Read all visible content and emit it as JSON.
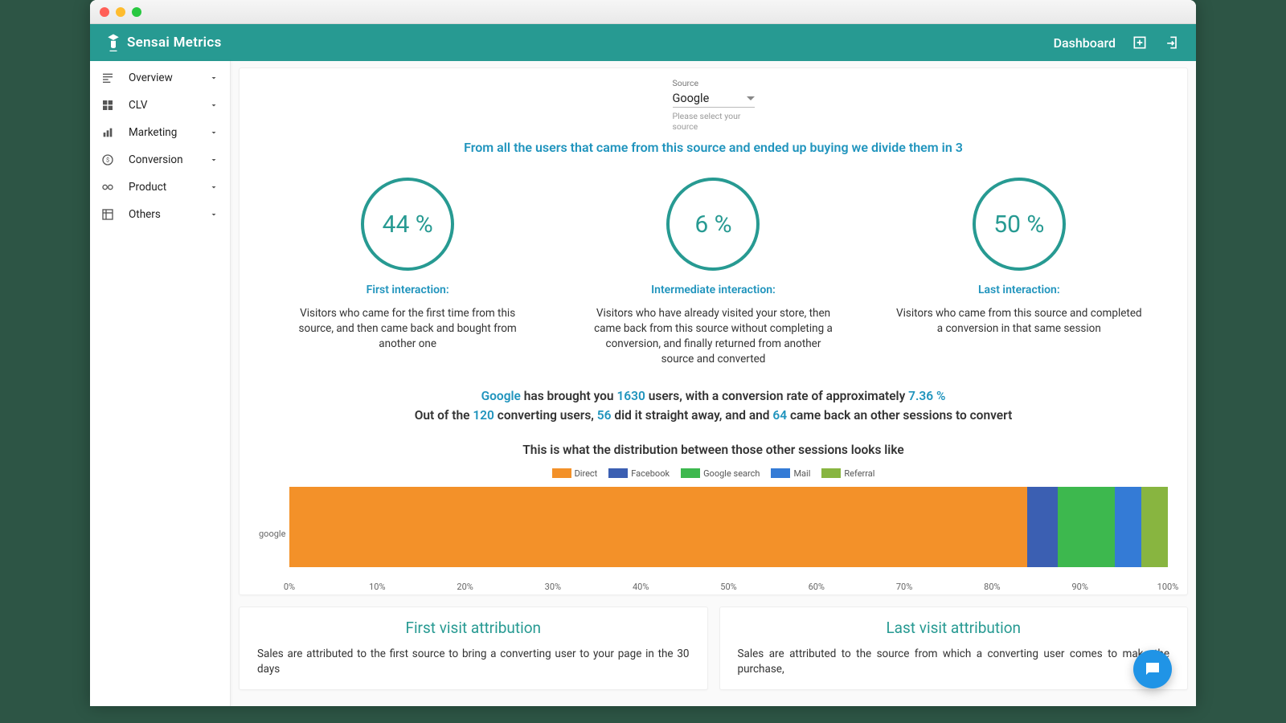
{
  "brand": "Sensai Metrics",
  "header": {
    "dashboard": "Dashboard"
  },
  "sidebar": {
    "items": [
      {
        "label": "Overview"
      },
      {
        "label": "CLV"
      },
      {
        "label": "Marketing"
      },
      {
        "label": "Conversion"
      },
      {
        "label": "Product"
      },
      {
        "label": "Others"
      }
    ]
  },
  "source": {
    "label": "Source",
    "value": "Google",
    "help": "Please select your source"
  },
  "intro": "From all the users that came from this source and ended up buying we divide them in 3",
  "metrics": [
    {
      "value": "44 %",
      "title": "First interaction:",
      "desc": "Visitors who came for the first time from this source, and then came back and bought from another one"
    },
    {
      "value": "6 %",
      "title": "Intermediate interaction:",
      "desc": "Visitors who have already visited your store, then came back from this source without completing a conversion, and finally returned from another source and converted"
    },
    {
      "value": "50 %",
      "title": "Last interaction:",
      "desc": "Visitors who came from this source and completed a conversion in that same session"
    }
  ],
  "summary": {
    "source": "Google",
    "users": "1630",
    "rate": "7.36 %",
    "converting": "120",
    "straight": "56",
    "came_back": "64",
    "t_has_brought": " has brought you ",
    "t_users_rate": " users, with a conversion rate of approximately ",
    "t_out_of": "Out of the ",
    "t_converting": " converting users, ",
    "t_did_straight": " did it straight away, and and ",
    "t_came_back": " came back an other sessions to convert"
  },
  "subhead": "This is what the distribution between those other sessions looks like",
  "chart_data": {
    "type": "bar",
    "orientation": "horizontal-stacked",
    "categories": [
      "google"
    ],
    "xlabel": "",
    "ylabel": "",
    "xlim": [
      0,
      100
    ],
    "xticks": [
      "0%",
      "10%",
      "20%",
      "30%",
      "40%",
      "50%",
      "60%",
      "70%",
      "80%",
      "90%",
      "100%"
    ],
    "series": [
      {
        "name": "Direct",
        "color": "#f39129",
        "values": [
          84
        ]
      },
      {
        "name": "Facebook",
        "color": "#3b5fb2",
        "values": [
          3.5
        ]
      },
      {
        "name": "Google search",
        "color": "#3db84e",
        "values": [
          6.5
        ]
      },
      {
        "name": "Mail",
        "color": "#347bd6",
        "values": [
          3
        ]
      },
      {
        "name": "Referral",
        "color": "#88b540",
        "values": [
          3
        ]
      }
    ]
  },
  "cards": {
    "first": {
      "title": "First visit attribution",
      "body": "Sales are attributed to the first source to bring a converting user to your page in the 30 days"
    },
    "last": {
      "title": "Last visit attribution",
      "body": "Sales are attributed to the source from which a converting user comes to make the purchase,"
    }
  }
}
